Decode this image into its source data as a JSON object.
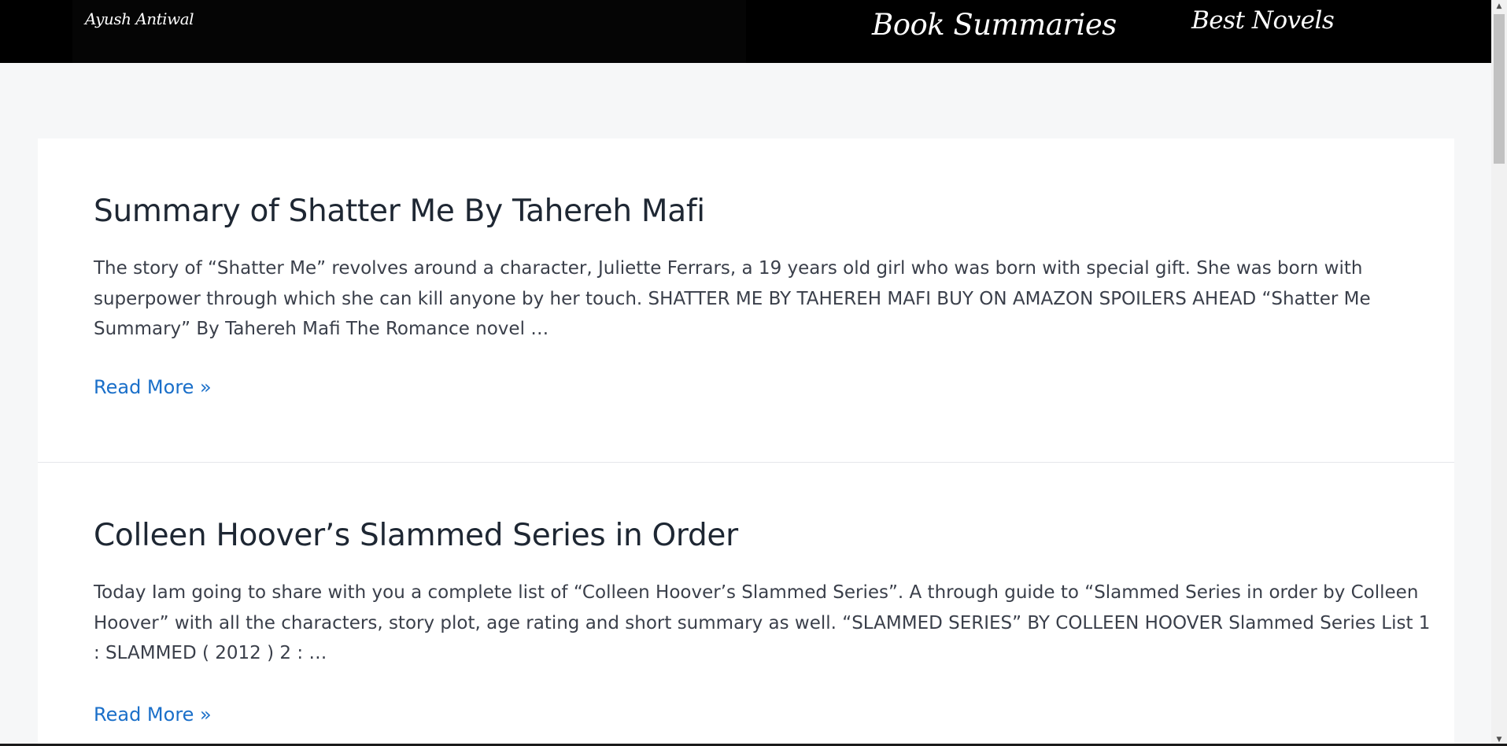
{
  "header": {
    "site_title": "Ayush Antiwal",
    "nav": [
      {
        "label": "Book Summaries"
      },
      {
        "label": "Best Novels"
      }
    ]
  },
  "posts": [
    {
      "title": "Summary of Shatter Me By Tahereh Mafi",
      "excerpt": "The story of “Shatter Me” revolves around a character, Juliette Ferrars, a 19 years old girl who was born with special gift. She was born with superpower through which she can kill anyone by her touch. SHATTER ME BY TAHEREH MAFI BUY ON AMAZON SPOILERS AHEAD “Shatter Me Summary” By Tahereh Mafi The Romance novel …",
      "read_more": "Read More »"
    },
    {
      "title": "Colleen Hoover’s Slammed Series in Order",
      "excerpt": "Today Iam going to share with you a complete list of “Colleen Hoover’s Slammed Series”. A through guide to “Slammed Series in order by Colleen Hoover” with all the characters, story plot, age rating and short summary as well. “SLAMMED SERIES” BY COLLEEN HOOVER Slammed Series List 1 : SLAMMED ( 2012 ) 2 : …",
      "read_more": "Read More »"
    }
  ],
  "scrollbar": {
    "up_icon": "triangle-up",
    "down_icon": "triangle-down"
  },
  "colors": {
    "header_bg": "#000000",
    "page_bg": "#f6f7f8",
    "link": "#1a6fc9",
    "title": "#1e2733"
  }
}
